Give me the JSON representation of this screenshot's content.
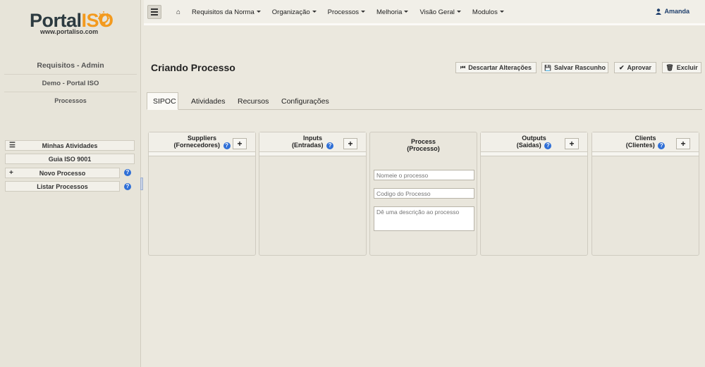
{
  "logo": {
    "portal": "Portal",
    "iso": "ISO",
    "url": "www.portaliso.com"
  },
  "sidebar": {
    "title": "Requisitos - Admin",
    "company": "Demo - Portal ISO",
    "section": "Processos",
    "items": [
      {
        "label": "Minhas Atividades",
        "icon": "list-icon"
      },
      {
        "label": "Guia ISO 9001"
      },
      {
        "label": "Novo Processo",
        "icon": "plus-icon",
        "help": "?"
      },
      {
        "label": "Listar Processos",
        "help": "?"
      }
    ]
  },
  "navbar": {
    "items": [
      "Requisitos da Norma",
      "Organização",
      "Processos",
      "Melhoria",
      "Visão Geral",
      "Modulos"
    ],
    "user": "Amanda"
  },
  "page": {
    "title": "Criando Processo",
    "actions": {
      "discard": "Descartar Alterações",
      "save_draft": "Salvar Rascunho",
      "approve": "Aprovar",
      "delete": "Excluir"
    },
    "tabs": [
      "SIPOC",
      "Atividades",
      "Recursos",
      "Configurações"
    ],
    "active_tab": "SIPOC"
  },
  "sipoc": {
    "suppliers": {
      "title": "Suppliers",
      "subtitle": "(Fornecedores)"
    },
    "inputs": {
      "title": "Inputs",
      "subtitle": "(Entradas)"
    },
    "process": {
      "title": "Process",
      "subtitle": "(Processo)",
      "name_placeholder": "Nomeie o processo",
      "code_placeholder": "Codigo do Processo",
      "description_placeholder": "Dê uma descrição ao processo"
    },
    "outputs": {
      "title": "Outputs",
      "subtitle": "(Saidas)"
    },
    "clients": {
      "title": "Clients",
      "subtitle": "(Clientes)"
    },
    "add_label": "+"
  },
  "colors": {
    "accent_orange": "#f39a1e",
    "help_blue": "#2f6fd6",
    "user_blue": "#1e3e6b"
  }
}
